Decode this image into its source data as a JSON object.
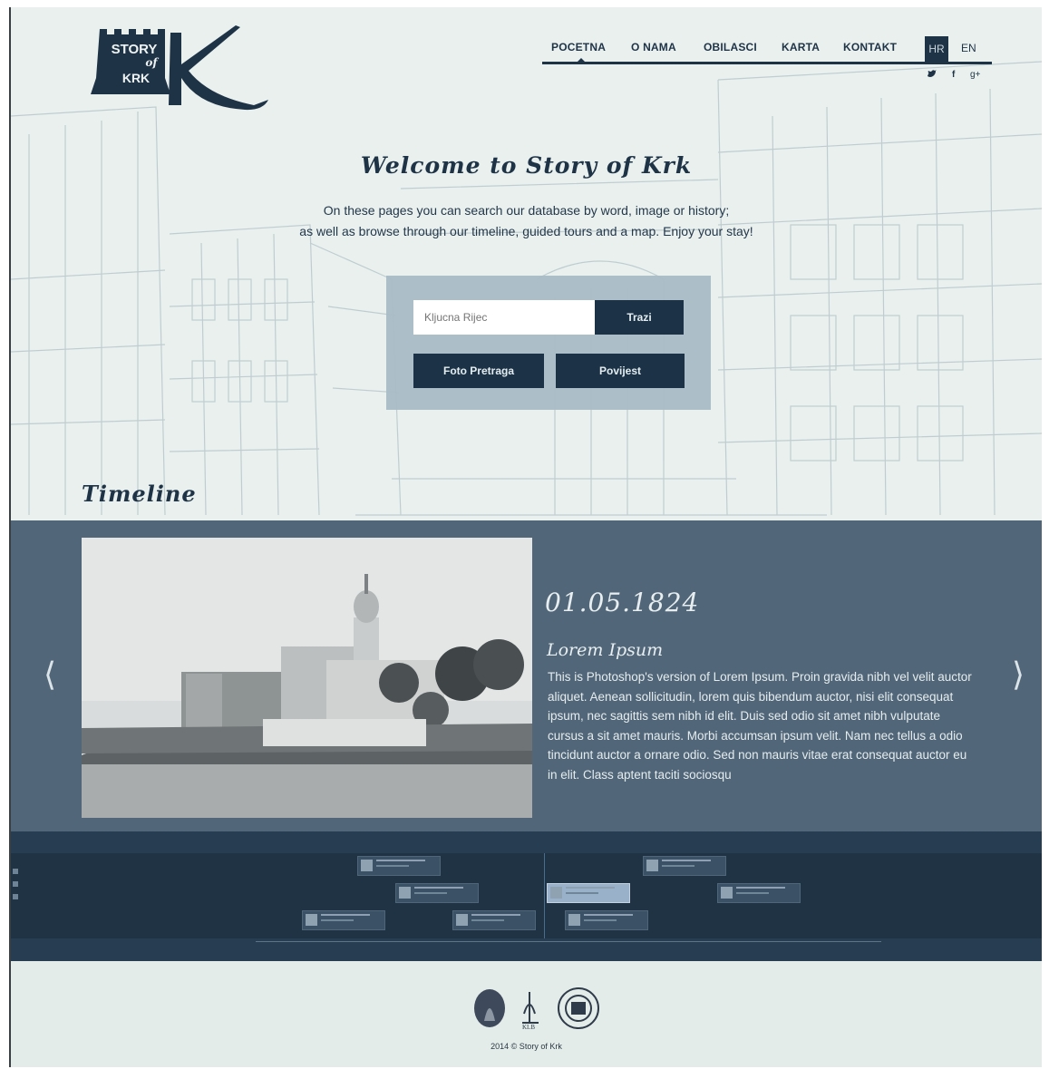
{
  "logo": {
    "line1": "STORY",
    "line2": "of",
    "line3": "KRK",
    "initial": "K"
  },
  "nav": {
    "items": [
      "POCETNA",
      "O NAMA",
      "OBILASCI",
      "KARTA",
      "KONTAKT"
    ],
    "active": "POCETNA",
    "lang_hr": "HR",
    "lang_en": "EN",
    "social": [
      "twitter-icon",
      "facebook-icon",
      "google-plus-icon"
    ]
  },
  "hero": {
    "title": "Welcome to Story of Krk",
    "intro_line1": "On these pages you can search our database by word, image or history;",
    "intro_line2": "as well as  browse through our timeline, guided tours and a map. Enjoy your stay!"
  },
  "search": {
    "placeholder": "Kljucna Rijec",
    "search_label": "Trazi",
    "photo_search_label": "Foto Pretraga",
    "history_label": "Povijest"
  },
  "timeline": {
    "heading": "Timeline",
    "date": "01.05.1824",
    "item_title": "Lorem Ipsum",
    "item_body": "This is Photoshop's version  of Lorem Ipsum. Proin gravida nibh vel velit auctor aliquet. Aenean sollicitudin, lorem quis bibendum auctor, nisi elit consequat ipsum, nec sagittis sem nibh id elit. Duis sed odio sit amet nibh vulputate cursus a sit amet mauris. Morbi accumsan ipsum velit. Nam nec tellus a odio tincidunt auctor a ornare odio. Sed non  mauris vitae erat consequat auctor eu in elit. Class aptent taciti sociosqu",
    "prev_arrow": "⟨",
    "next_arrow": "⟩"
  },
  "footer": {
    "copyright": "2014 © Story of Krk",
    "logos": [
      "partner-logo-1",
      "partner-logo-2",
      "partner-logo-3"
    ]
  },
  "colors": {
    "navy": "#1f3347",
    "slider_bg": "#40586c",
    "page_bg": "#e9f0ee"
  }
}
